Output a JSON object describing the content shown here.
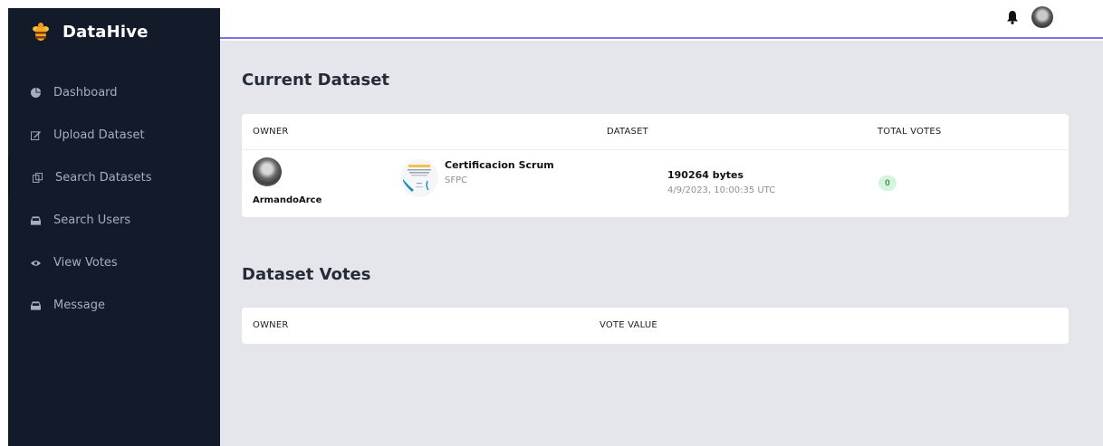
{
  "brand": {
    "name": "DataHive"
  },
  "sidebar": {
    "items": [
      {
        "label": "Dashboard",
        "icon": "pie-chart-icon"
      },
      {
        "label": "Upload Dataset",
        "icon": "edit-icon"
      },
      {
        "label": "Search Datasets",
        "icon": "copy-icon",
        "active": true
      },
      {
        "label": "Search Users",
        "icon": "inbox-icon"
      },
      {
        "label": "View Votes",
        "icon": "eye-icon"
      },
      {
        "label": "Message",
        "icon": "inbox-icon"
      }
    ]
  },
  "topbar": {
    "icons": [
      "bell-icon",
      "user-avatar"
    ]
  },
  "current_dataset": {
    "title": "Current Dataset",
    "columns": [
      "OWNER",
      "DATASET",
      "TOTAL VOTES"
    ],
    "row": {
      "owner": "ArmandoArce",
      "dataset_name": "Certificacion Scrum",
      "dataset_sub": "SFPC",
      "size": "190264 bytes",
      "timestamp": "4/9/2023, 10:00:35 UTC",
      "total_votes": "0"
    }
  },
  "dataset_votes": {
    "title": "Dataset Votes",
    "columns": [
      "OWNER",
      "VOTE VALUE"
    ]
  },
  "colors": {
    "sidebar_bg": "#131a29",
    "accent_line": "#7a73e8",
    "main_bg": "#e5e6eb",
    "badge_bg": "#d3f5dc"
  }
}
